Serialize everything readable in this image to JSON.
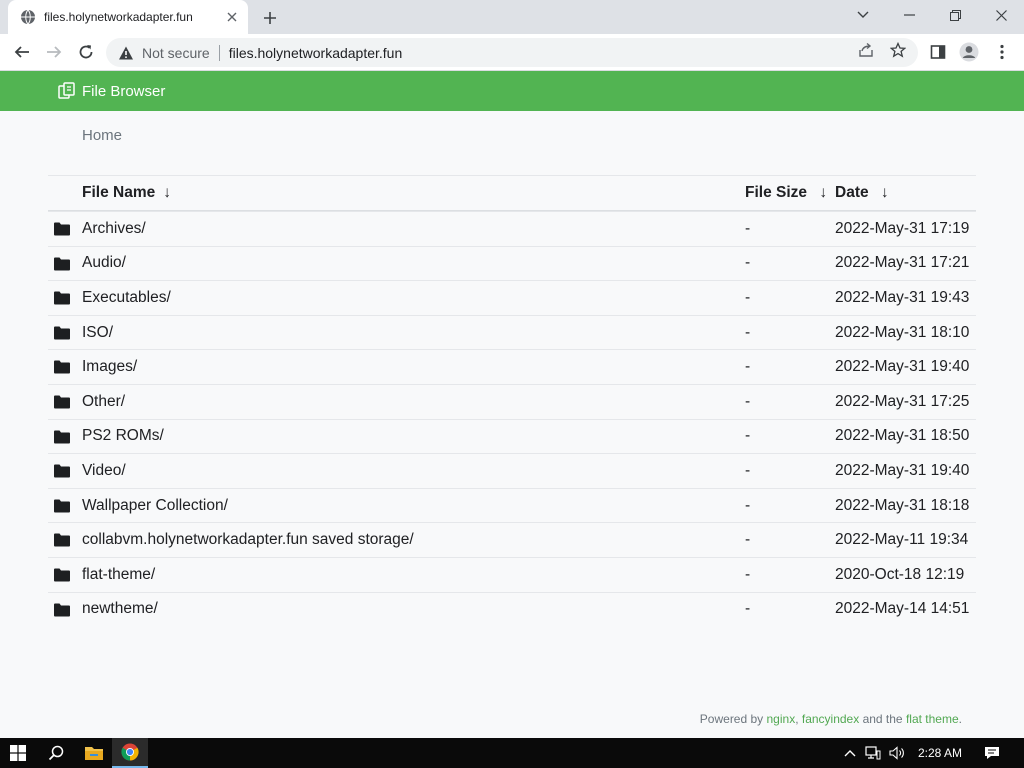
{
  "browser": {
    "tab_title": "files.holynetworkadapter.fun",
    "not_secure_label": "Not secure",
    "address": "files.holynetworkadapter.fun"
  },
  "app": {
    "title": "File Browser"
  },
  "breadcrumb": {
    "home": "Home"
  },
  "table": {
    "columns": {
      "name": "File Name",
      "size": "File Size",
      "date": "Date",
      "sort_glyph": "↓"
    },
    "rows": [
      {
        "name": "Archives/",
        "size": "-",
        "date": "2022-May-31 17:19"
      },
      {
        "name": "Audio/",
        "size": "-",
        "date": "2022-May-31 17:21"
      },
      {
        "name": "Executables/",
        "size": "-",
        "date": "2022-May-31 19:43"
      },
      {
        "name": "ISO/",
        "size": "-",
        "date": "2022-May-31 18:10"
      },
      {
        "name": "Images/",
        "size": "-",
        "date": "2022-May-31 19:40"
      },
      {
        "name": "Other/",
        "size": "-",
        "date": "2022-May-31 17:25"
      },
      {
        "name": "PS2 ROMs/",
        "size": "-",
        "date": "2022-May-31 18:50"
      },
      {
        "name": "Video/",
        "size": "-",
        "date": "2022-May-31 19:40"
      },
      {
        "name": "Wallpaper Collection/",
        "size": "-",
        "date": "2022-May-31 18:18"
      },
      {
        "name": "collabvm.holynetworkadapter.fun saved storage/",
        "size": "-",
        "date": "2022-May-11 19:34"
      },
      {
        "name": "flat-theme/",
        "size": "-",
        "date": "2020-Oct-18 12:19"
      },
      {
        "name": "newtheme/",
        "size": "-",
        "date": "2022-May-14 14:51"
      }
    ]
  },
  "footer": {
    "prefix": "Powered by ",
    "nginx": "nginx",
    "comma": ", ",
    "fancyindex": "fancyindex",
    "middle": " and the ",
    "theme": "flat theme",
    "suffix": "."
  },
  "taskbar": {
    "time": "2:28 AM"
  },
  "colors": {
    "header": "#52b452",
    "link_green": "#52a852"
  }
}
